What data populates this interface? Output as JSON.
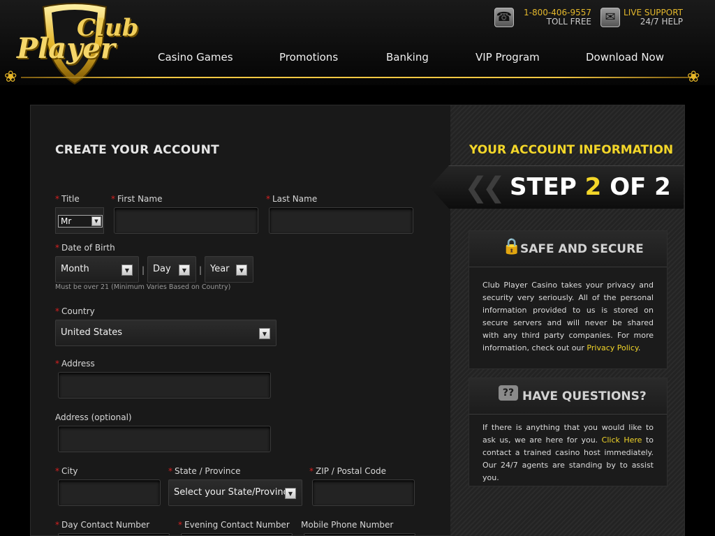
{
  "logo": {
    "line1": "Club",
    "line2": "Player"
  },
  "nav": {
    "items": [
      "Casino Games",
      "Promotions",
      "Banking",
      "VIP Program",
      "Download Now"
    ]
  },
  "contact": {
    "phone": "1-800-406-9557",
    "phone_sub": "TOLL FREE",
    "support": "LIVE SUPPORT",
    "support_sub": "24/7 HELP"
  },
  "form": {
    "title": "CREATE YOUR ACCOUNT",
    "required_mark": "*",
    "title_label": "Title",
    "title_value": "Mr",
    "first_name_label": "First Name",
    "last_name_label": "Last Name",
    "dob_label": "Date of Birth",
    "dob_month": "Month",
    "dob_day": "Day",
    "dob_year": "Year",
    "dob_separator": "|",
    "dob_hint": "Must be over 21 (Minimum Varies Based on Country)",
    "country_label": "Country",
    "country_value": "United States",
    "address_label": "Address",
    "address2_label": "Address (optional)",
    "city_label": "City",
    "state_label": "State / Province",
    "state_value": "Select your State/Province",
    "zip_label": "ZIP / Postal Code",
    "day_phone_label": "Day Contact Number",
    "evening_phone_label": "Evening Contact Number",
    "mobile_label": "Mobile Phone Number"
  },
  "sidebar": {
    "heading": "YOUR ACCOUNT INFORMATION",
    "step_prefix": "STEP",
    "step_current": "2",
    "step_mid": "OF",
    "step_total": "2",
    "safe": {
      "title": "SAFE AND SECURE",
      "text": "Club Player Casino takes your privacy and security very seriously. All of the personal information provided to us is stored on secure servers and will never be shared with any third party companies. For more information, check out our ",
      "link": "Privacy Policy",
      "after": "."
    },
    "questions": {
      "title": "HAVE QUESTIONS?",
      "text1": "If there is anything that you would like to ask us, we are here for you. ",
      "link": "Click Here",
      "text2": " to contact a trained casino host immediately. Our 24/7 agents are standing by to assist you."
    }
  },
  "colors": {
    "accent": "#f3d629",
    "required": "#d62020",
    "background": "#000000"
  }
}
